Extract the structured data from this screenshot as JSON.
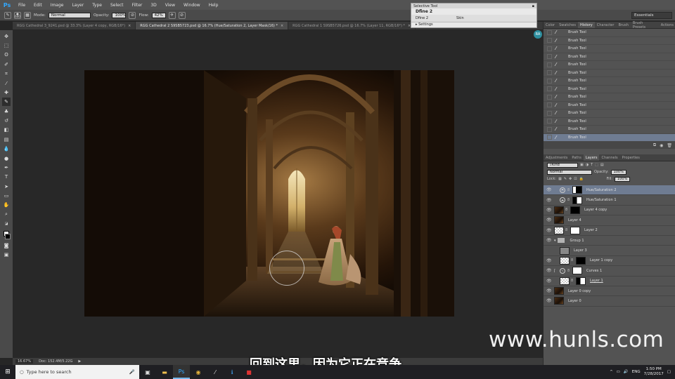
{
  "menubar": {
    "logo": "Ps",
    "items": [
      "File",
      "Edit",
      "Image",
      "Layer",
      "Type",
      "Select",
      "Filter",
      "3D",
      "View",
      "Window",
      "Help"
    ]
  },
  "options": {
    "brush_size": "600",
    "mode_label": "Mode:",
    "mode_value": "Normal",
    "opacity_label": "Opacity:",
    "opacity_value": "100%",
    "flow_label": "Flow:",
    "flow_value": "42%",
    "workspace": "Essentials"
  },
  "tabs": [
    {
      "label": "RGG Cathedral 3_9241.psd @ 33.3% (Layer 4 copy, RGB/16*)",
      "active": false
    },
    {
      "label": "RGG Cathedral 2 S9SB5723.psd @ 16.7% (Hue/Saturation 2, Layer Mask/16) *",
      "active": true
    },
    {
      "label": "RGG Cathedral 1 S9SB5726.psd @ 16.7% (Layer 11, RGB/16*) *",
      "active": false
    }
  ],
  "selective_tool": {
    "title": "Selective Tool",
    "heading": "Dfine 2",
    "col1": "Dfine 2",
    "col2": "Skin",
    "settings": "Settings"
  },
  "history": {
    "tabs": [
      "Color",
      "Swatches",
      "History",
      "Character",
      "Brush",
      "Brush Presets",
      "Actions"
    ],
    "active_tab": "History",
    "items": [
      "Brush Tool",
      "Brush Tool",
      "Brush Tool",
      "Brush Tool",
      "Brush Tool",
      "Brush Tool",
      "Brush Tool",
      "Brush Tool",
      "Brush Tool",
      "Brush Tool",
      "Brush Tool",
      "Brush Tool",
      "Brush Tool",
      "Brush Tool"
    ],
    "active_index": 13
  },
  "layers_panel": {
    "tabs": [
      "Adjustments",
      "Paths",
      "Layers",
      "Channels",
      "Properties"
    ],
    "active_tab": "Layers",
    "kind_label": "Kind",
    "blend_mode": "Normal",
    "opacity_label": "Opacity:",
    "opacity_value": "100%",
    "lock_label": "Lock:",
    "fill_label": "Fill:",
    "fill_value": "100%",
    "layers": [
      {
        "name": "Hue/Saturation 2",
        "active": true
      },
      {
        "name": "Hue/Saturation 1",
        "active": false
      },
      {
        "name": "Layer 4 copy",
        "active": false
      },
      {
        "name": "Layer 4",
        "active": false
      },
      {
        "name": "Layer 2",
        "active": false
      },
      {
        "name": "Group 1",
        "active": false
      },
      {
        "name": "Layer 3",
        "active": false
      },
      {
        "name": "Layer 1 copy",
        "active": false
      },
      {
        "name": "Curves 1",
        "active": false
      },
      {
        "name": "Layer 1",
        "active": false
      },
      {
        "name": "Layer 0 copy",
        "active": false
      },
      {
        "name": "Layer 0",
        "active": false
      }
    ]
  },
  "status": {
    "zoom": "16.67%",
    "doc": "Doc: 152.4M/5.22G"
  },
  "avatar": "RA",
  "watermark": "www.hunls.com",
  "subtitle": "回到这里，因为它正在竞争",
  "taskbar": {
    "search_placeholder": "Type here to search",
    "lang": "ENG",
    "time": "1:50 PM",
    "date": "7/28/2017"
  }
}
